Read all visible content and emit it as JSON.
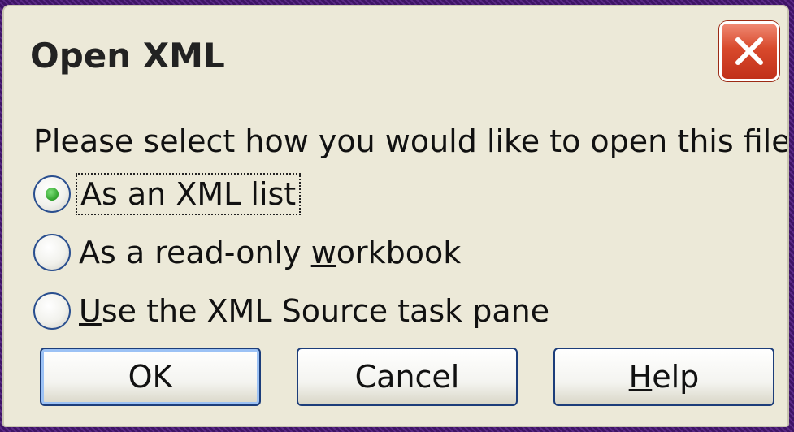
{
  "dialog": {
    "title": "Open XML",
    "prompt": "Please select how you would like to open this file:"
  },
  "options": [
    {
      "pre": "",
      "underline": "",
      "label": "As an XML list",
      "selected": true
    },
    {
      "pre": "As a read-only ",
      "underline": "w",
      "post": "orkbook",
      "selected": false
    },
    {
      "pre": "",
      "underline": "U",
      "post": "se the XML Source task pane",
      "selected": false
    }
  ],
  "option1_label": "As an XML list",
  "option2_pre": "As a read-only ",
  "option2_u": "w",
  "option2_post": "orkbook",
  "option3_u": "U",
  "option3_post": "se the XML Source task pane",
  "buttons": {
    "ok": "OK",
    "cancel": "Cancel",
    "help_u": "H",
    "help_rest": "elp"
  },
  "icons": {
    "close": "close-icon"
  },
  "colors": {
    "dialog_bg": "#ece9d8",
    "close_red": "#d8492c",
    "radio_selected": "#2ea12a"
  }
}
